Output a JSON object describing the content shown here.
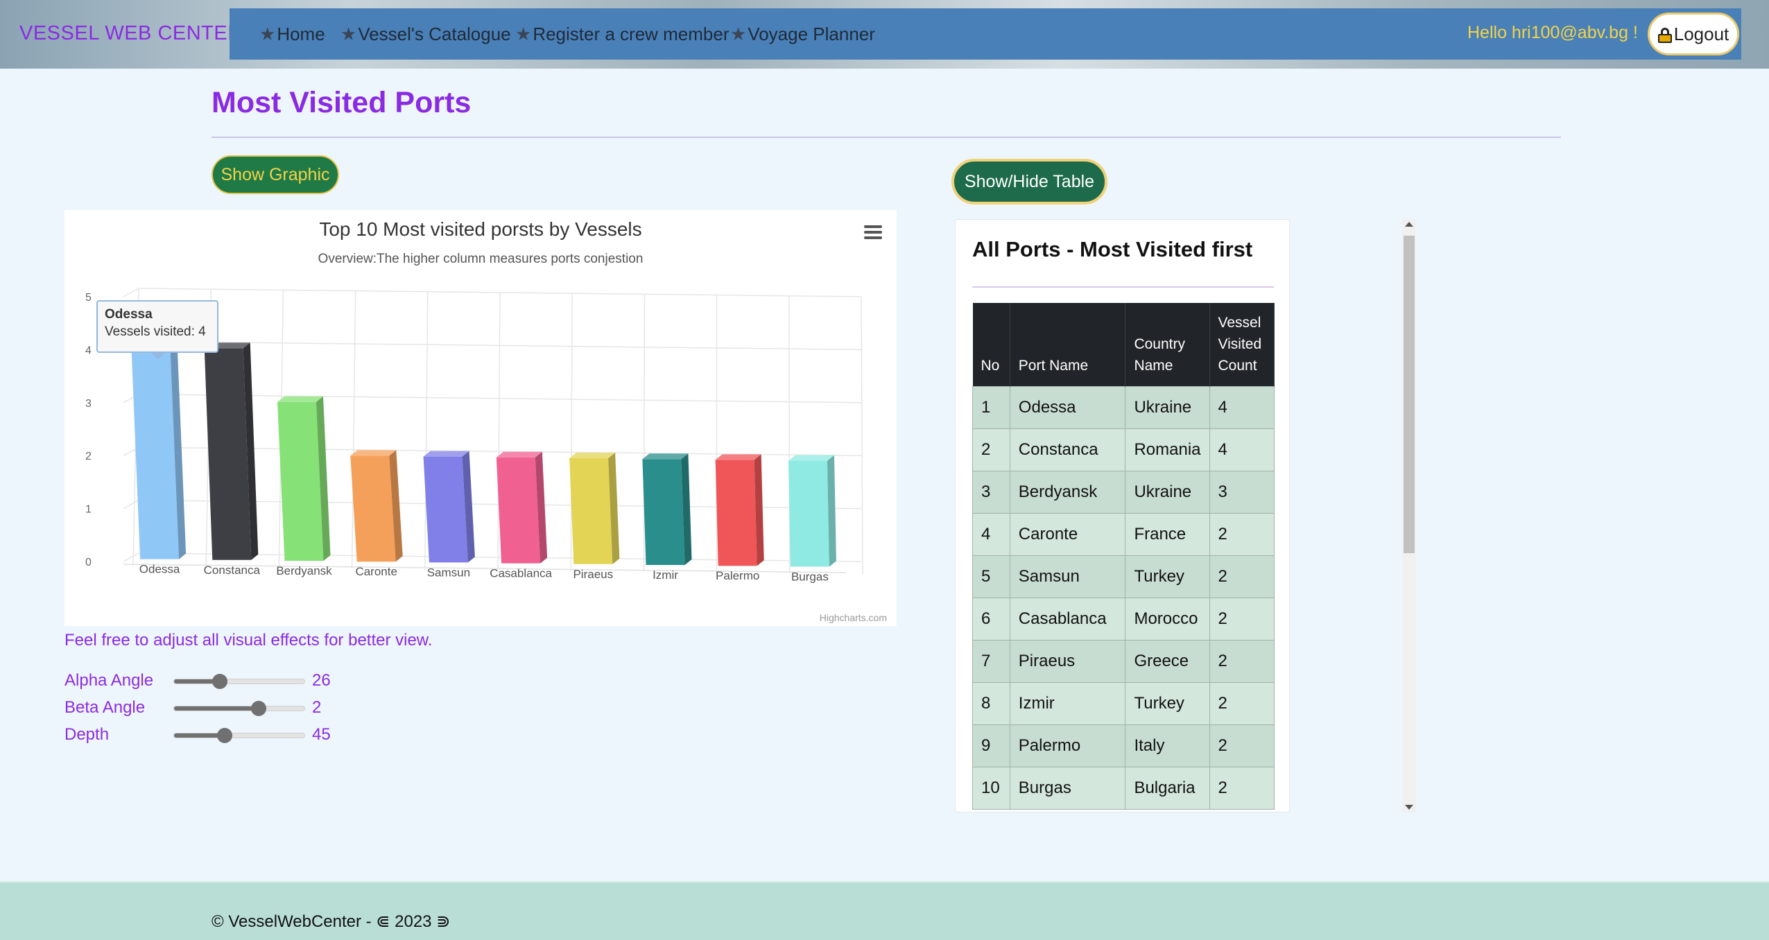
{
  "header": {
    "brand": "VESSEL WEB CENTER",
    "nav": [
      {
        "label": "Home"
      },
      {
        "label": "Vessel's Catalogue"
      },
      {
        "label": "Register a crew member"
      },
      {
        "label": "Voyage Planner"
      }
    ],
    "greeting": "Hello hri100@abv.bg !",
    "logout_label": "Logout"
  },
  "page": {
    "title": "Most Visited Ports",
    "show_graphic_label": "Show Graphic",
    "toggle_table_label": "Show/Hide Table",
    "hint": "Feel free to adjust all visual effects for better view."
  },
  "chart_data": {
    "type": "bar",
    "title": "Top 10 Most visited porsts by Vessels",
    "subtitle": "Overview:The higher column measures ports conjestion",
    "categories": [
      "Odessa",
      "Constanca",
      "Berdyansk",
      "Caronte",
      "Samsun",
      "Casablanca",
      "Piraeus",
      "Izmir",
      "Palermo",
      "Burgas"
    ],
    "values": [
      4,
      4,
      3,
      2,
      2,
      2,
      2,
      2,
      2,
      2
    ],
    "colors": [
      "#8fc7f7",
      "#3e3e45",
      "#86e176",
      "#f5a05a",
      "#8080e8",
      "#f06090",
      "#e3d456",
      "#2a8f8c",
      "#f05558",
      "#8eeae2"
    ],
    "yticks": [
      "0",
      "1",
      "2",
      "3",
      "4",
      "5"
    ],
    "ylim": [
      0,
      5
    ],
    "grid": true,
    "legend": false,
    "tooltip": {
      "title": "Odessa",
      "line": "Vessels visited: 4"
    },
    "credits": "Highcharts.com"
  },
  "controls": [
    {
      "label": "Alpha Angle",
      "value": "26",
      "fraction": 0.35
    },
    {
      "label": "Beta Angle",
      "value": "2",
      "fraction": 0.65
    },
    {
      "label": "Depth",
      "value": "45",
      "fraction": 0.39
    }
  ],
  "table": {
    "title": "All Ports - Most Visited first",
    "headers": {
      "no": "No",
      "port": "Port Name",
      "country": "Country Name",
      "count": "Vessel Visited Count"
    },
    "rows": [
      {
        "no": "1",
        "port": "Odessa",
        "country": "Ukraine",
        "count": "4"
      },
      {
        "no": "2",
        "port": "Constanca",
        "country": "Romania",
        "count": "4"
      },
      {
        "no": "3",
        "port": "Berdyansk",
        "country": "Ukraine",
        "count": "3"
      },
      {
        "no": "4",
        "port": "Caronte",
        "country": "France",
        "count": "2"
      },
      {
        "no": "5",
        "port": "Samsun",
        "country": "Turkey",
        "count": "2"
      },
      {
        "no": "6",
        "port": "Casablanca",
        "country": "Morocco",
        "count": "2"
      },
      {
        "no": "7",
        "port": "Piraeus",
        "country": "Greece",
        "count": "2"
      },
      {
        "no": "8",
        "port": "Izmir",
        "country": "Turkey",
        "count": "2"
      },
      {
        "no": "9",
        "port": "Palermo",
        "country": "Italy",
        "count": "2"
      },
      {
        "no": "10",
        "port": "Burgas",
        "country": "Bulgaria",
        "count": "2"
      }
    ]
  },
  "footer": {
    "text": "© VesselWebCenter - ⋐ 2023 ⋑"
  }
}
